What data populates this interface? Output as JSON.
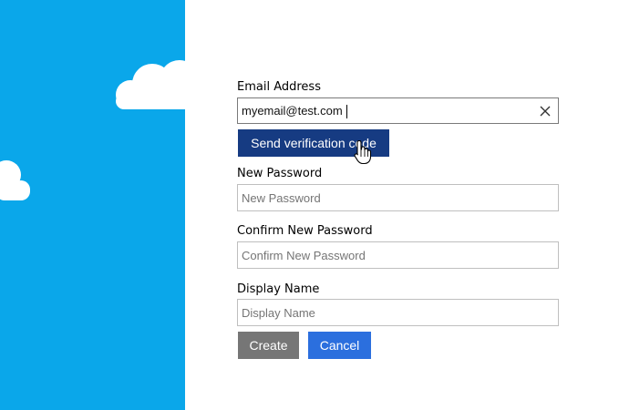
{
  "form": {
    "email": {
      "label": "Email Address",
      "value": "myemail@test.com"
    },
    "send_code_label": "Send verification code",
    "new_password": {
      "label": "New Password",
      "placeholder": "New Password"
    },
    "confirm_password": {
      "label": "Confirm New Password",
      "placeholder": "Confirm New Password"
    },
    "display_name": {
      "label": "Display Name",
      "placeholder": "Display Name"
    },
    "create_label": "Create",
    "cancel_label": "Cancel"
  },
  "icons": {
    "clear": "close-icon",
    "cursor": "hand-pointer-icon",
    "clouds": "cloud-icon"
  },
  "colors": {
    "side_panel": "#0aa7ea",
    "verify_button": "#163b82",
    "create_button": "#767676",
    "cancel_button": "#2b6fde"
  }
}
